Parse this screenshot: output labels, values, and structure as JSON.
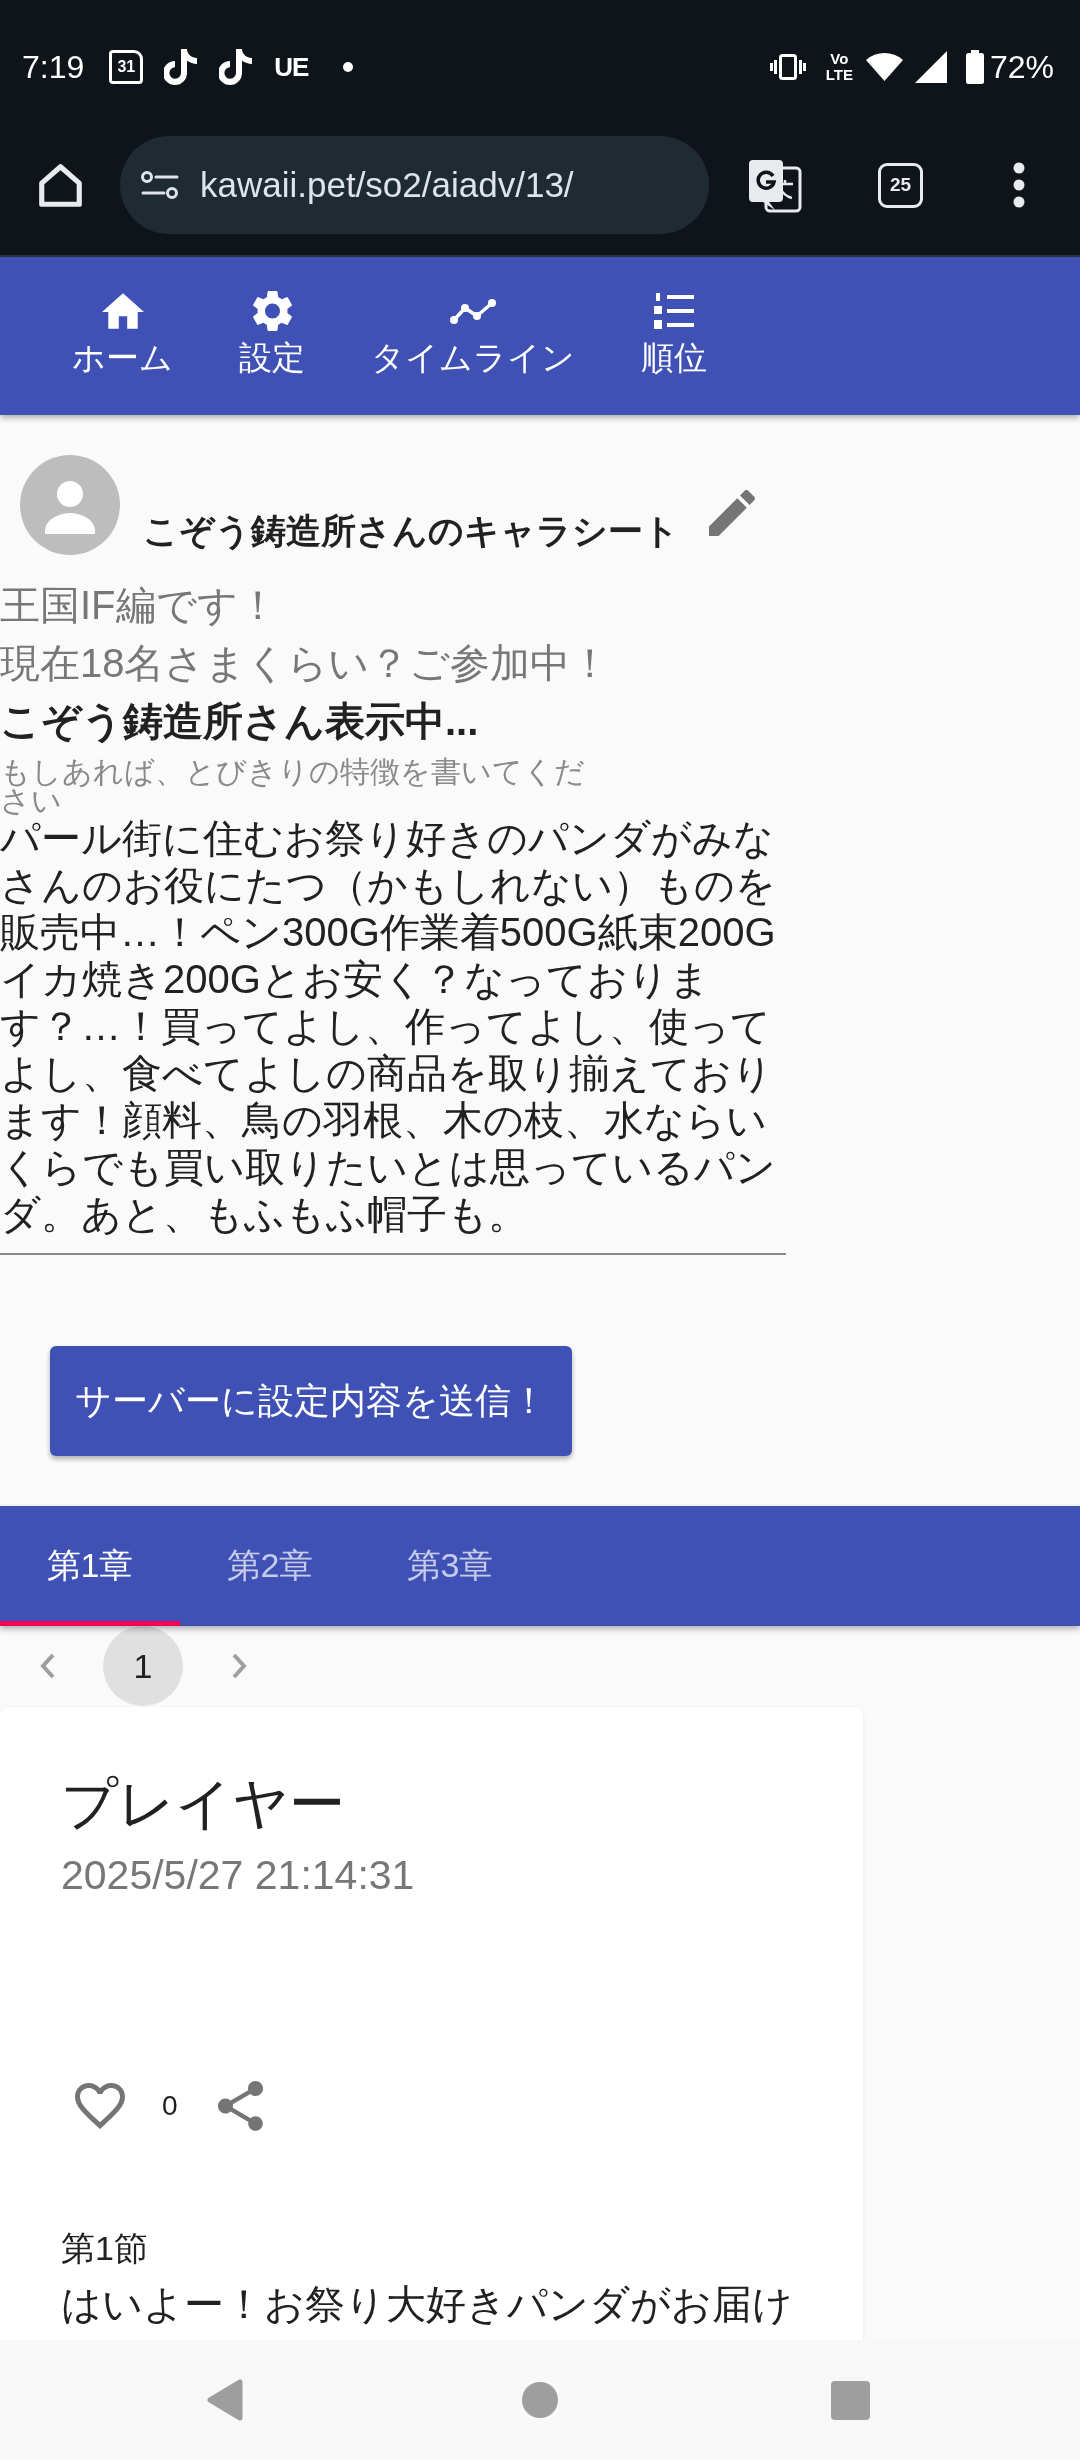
{
  "status_bar": {
    "time": "7:19",
    "notifications": [
      {
        "kind": "calendar",
        "text": "31"
      },
      {
        "kind": "tiktok"
      },
      {
        "kind": "tiktok"
      },
      {
        "kind": "letters",
        "text": "UE"
      },
      {
        "kind": "dot"
      }
    ],
    "network_type": [
      "Vo",
      "LTE"
    ],
    "battery": "72%"
  },
  "browser": {
    "url": "kawaii.pet/so2/aiadv/13/",
    "tab_count": "25"
  },
  "toolbar": {
    "items": [
      {
        "kind": "home",
        "label": "ホーム"
      },
      {
        "kind": "settings",
        "label": "設定"
      },
      {
        "kind": "timeline",
        "label": "タイムライン"
      },
      {
        "kind": "ranking",
        "label": "順位"
      }
    ]
  },
  "character_sheet": {
    "title": "こぞう鋳造所さんのキャラシート",
    "notices": [
      "王国IF編です！",
      "現在18名さまくらい？ご参加中！"
    ],
    "viewing": "こぞう鋳造所さん表示中...",
    "feature_field": {
      "label": "もしあれば、とびきりの特徴を書いてください",
      "value": "パール街に住むお祭り好きのパンダがみなさんのお役にたつ（かもしれない）ものを販売中…！ペン300G作業着500G紙束200Gイカ焼き200Gとお安く？なっております？…！買ってよし、作ってよし、使ってよし、食べてよしの商品を取り揃えております！顔料、鳥の羽根、木の枝、水ならいくらでも買い取りたいとは思っているパンダ。あと、もふもふ帽子も。"
    },
    "submit_button": "サーバーに設定内容を送信！"
  },
  "chapter_tabs": [
    {
      "label": "第1章",
      "selected": true
    },
    {
      "label": "第2章",
      "selected": false
    },
    {
      "label": "第3章",
      "selected": false
    }
  ],
  "pagination": {
    "pages": [
      {
        "label": "1",
        "selected": true
      }
    ]
  },
  "post": {
    "title": "プレイヤー",
    "date": "2025/5/27 21:14:31",
    "likes": "0",
    "section": "第1節",
    "body": "はいよー！お祭り大好きパンダがお届け"
  }
}
